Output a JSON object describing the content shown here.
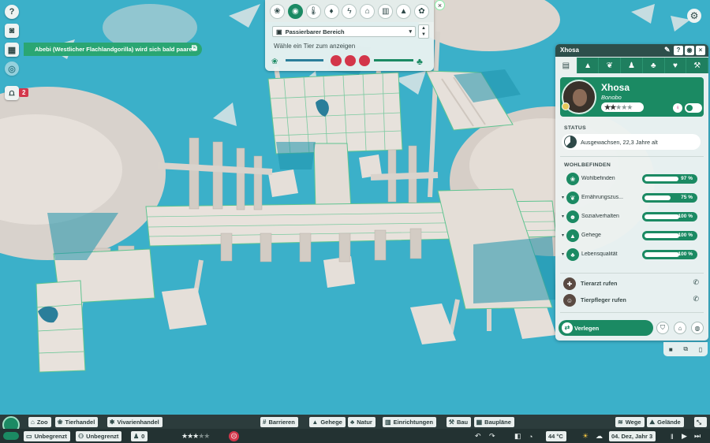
{
  "left_icons": [
    "help-icon",
    "camera-icon",
    "calendar-icon",
    "settings-dim-icon",
    "gate-icon"
  ],
  "guest_gate_count": "2",
  "notification": {
    "text": "Abebi (Westlicher Flachlandgorilla) wird sich bald paaren"
  },
  "toolbar": {
    "tabs": [
      "paw-icon",
      "binoculars-icon",
      "thermometer-icon",
      "drop-icon",
      "bolt-icon",
      "hut-icon",
      "stats-icon",
      "mortarboard-icon",
      "animals-icon"
    ],
    "dropdown_value": "Passierbarer Bereich",
    "hint": "Wähle ein Tier zum anzeigen"
  },
  "panel": {
    "title": "Xhosa",
    "tabs": [
      "clipboard-icon",
      "mountain-icon",
      "leaf-icon",
      "family-icon",
      "tree-icon",
      "heart-icon",
      "dumbbell-icon"
    ],
    "animal": {
      "name": "Xhosa",
      "species": "Bonobo",
      "rating": 2,
      "max_rating": 5,
      "sex": "♀"
    },
    "status_title": "STATUS",
    "status_text": "Ausgewachsen, 22,3 Jahre alt",
    "wellbeing_title": "WOHLBEFINDEN",
    "wellbeing": [
      {
        "label": "Wohlbefinden",
        "value": 97,
        "pct": "97 %",
        "icon": "paw-icon",
        "expandable": false
      },
      {
        "label": "Ernährungszus...",
        "value": 75,
        "pct": "75 %",
        "icon": "food-icon",
        "expandable": true
      },
      {
        "label": "Sozialverhalten",
        "value": 100,
        "pct": "100 %",
        "icon": "social-icon",
        "expandable": true
      },
      {
        "label": "Gehege",
        "value": 100,
        "pct": "100 %",
        "icon": "habitat-icon",
        "expandable": true
      },
      {
        "label": "Lebensqualität",
        "value": 100,
        "pct": "100 %",
        "icon": "quality-icon",
        "expandable": true
      }
    ],
    "vet_label": "Tierarzt rufen",
    "keeper_label": "Tierpfleger rufen",
    "move_label": "Verlegen"
  },
  "bottom": {
    "row1_left": [
      {
        "label": "Zoo",
        "icon": "zoo-icon"
      },
      {
        "label": "Tierhandel",
        "icon": "paw-icon"
      },
      {
        "label": "Vivarienhandel",
        "icon": "spider-icon"
      }
    ],
    "row1_center": [
      {
        "label": "Barrieren",
        "icon": "fence-icon"
      },
      {
        "label": "Gehege",
        "icon": "habitat-icon"
      },
      {
        "label": "Natur",
        "icon": "tree-icon"
      },
      {
        "label": "Einrichtungen",
        "icon": "facility-icon"
      },
      {
        "label": "Bau",
        "icon": "build-icon"
      },
      {
        "label": "Baupläne",
        "icon": "blueprint-icon"
      }
    ],
    "row1_right": [
      {
        "label": "Wege",
        "icon": "path-icon"
      },
      {
        "label": "Gelände",
        "icon": "terrain-icon"
      }
    ],
    "money": "Unbegrenzt",
    "research": "Unbegrenzt",
    "guests": "0",
    "zoo_rating": 3,
    "temperature": "44 °C",
    "date": "04. Dez, Jahr 3"
  }
}
